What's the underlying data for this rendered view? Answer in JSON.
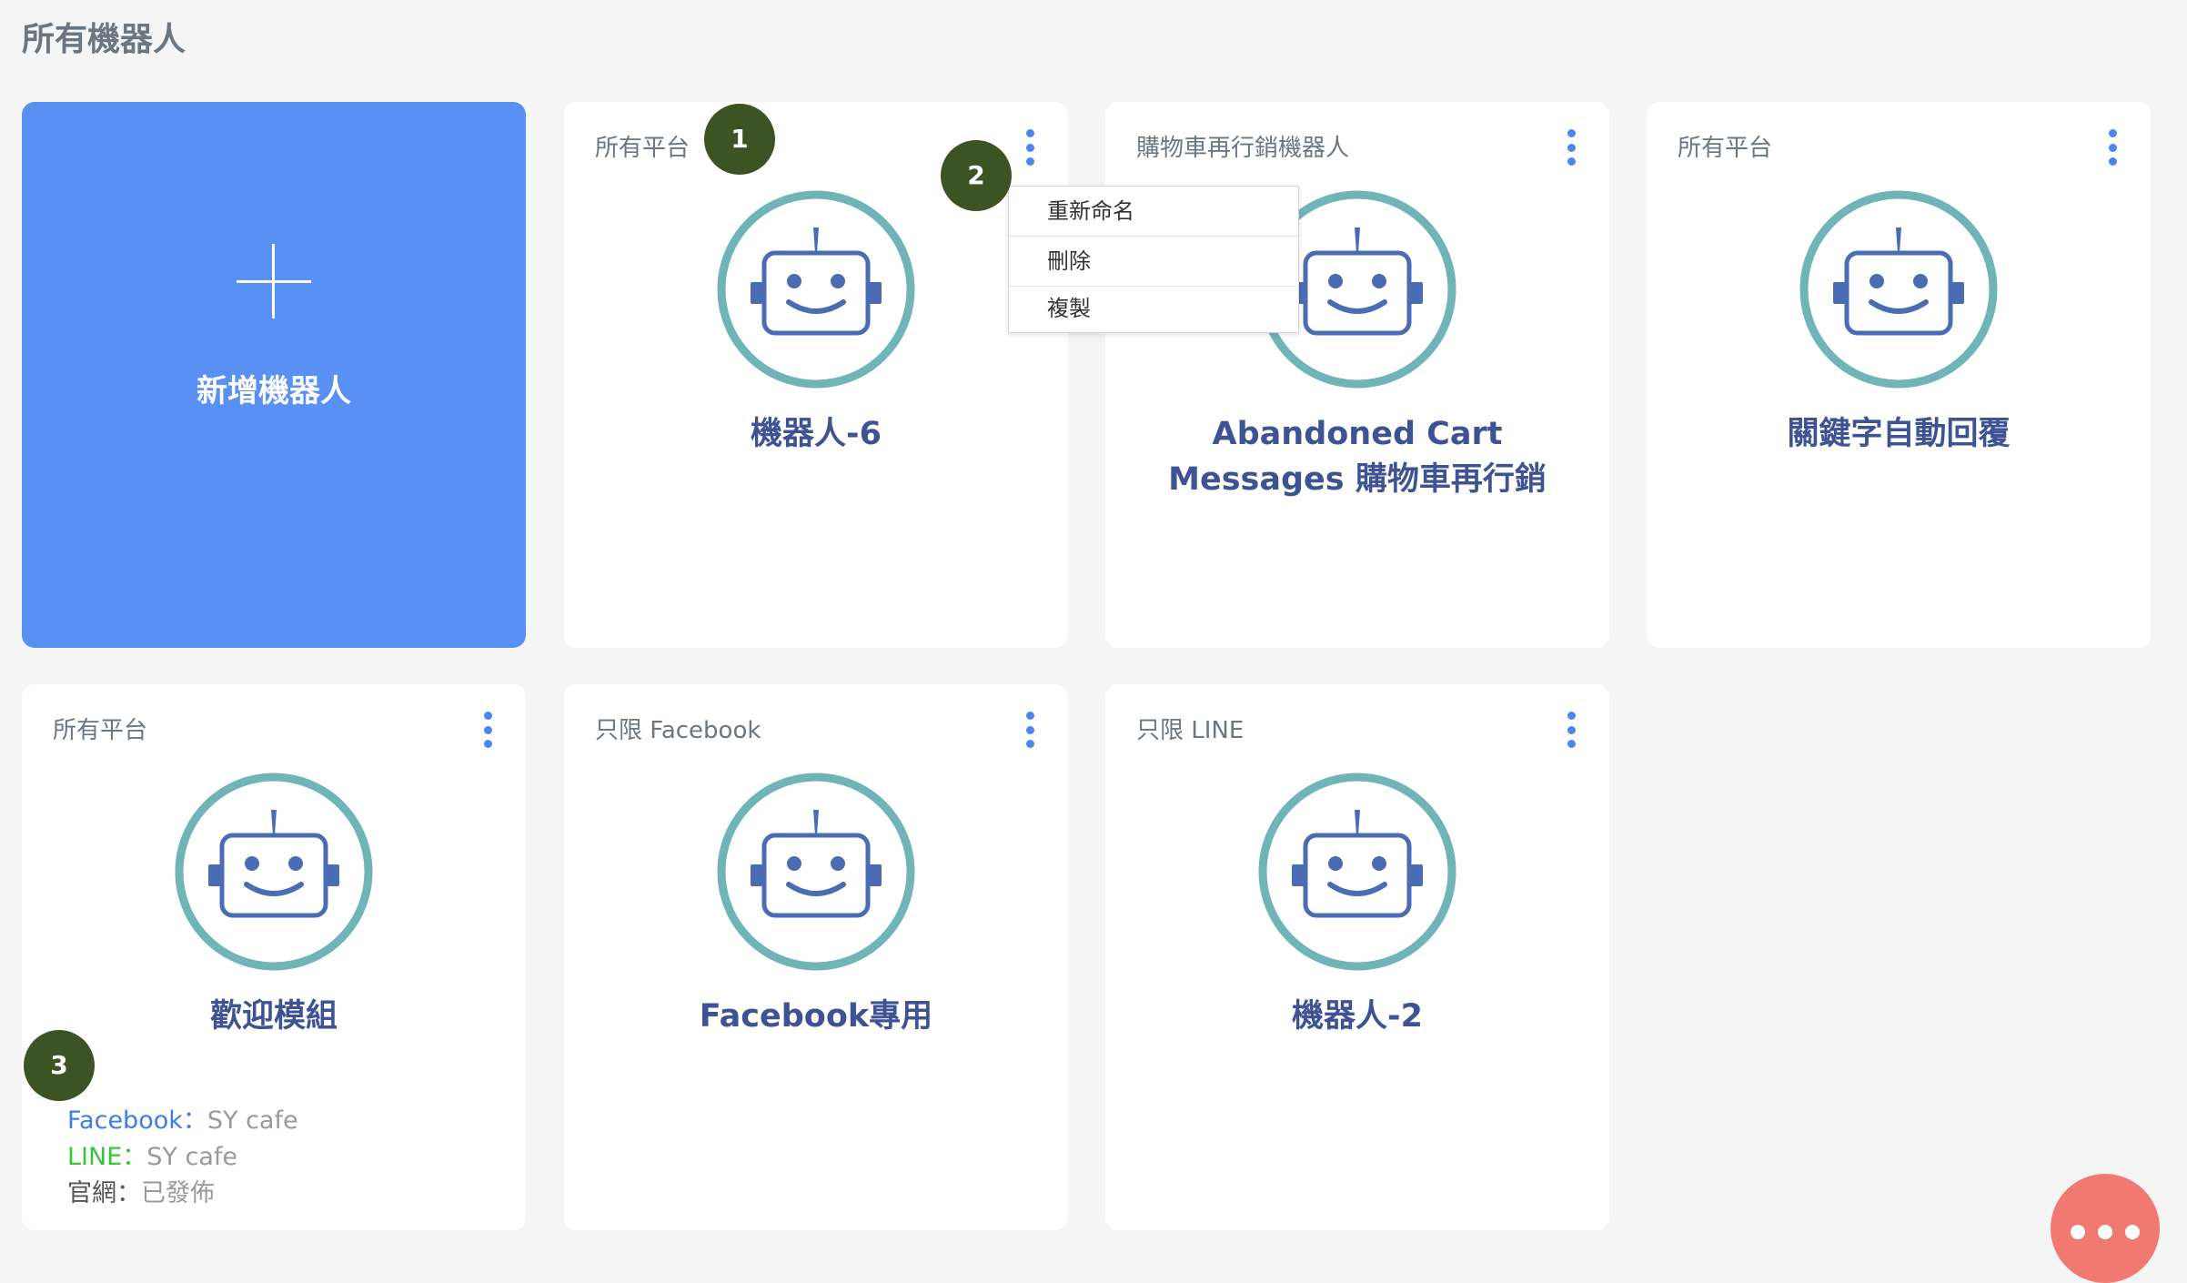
{
  "page_title": "所有機器人",
  "add_card": {
    "label": "新增機器人"
  },
  "bots": [
    {
      "platform": "所有平台",
      "name": "機器人-6"
    },
    {
      "platform": "購物車再行銷機器人",
      "name_line1": "Abandoned Cart",
      "name_line2": "Messages 購物車再行銷"
    },
    {
      "platform": "所有平台",
      "name": "關鍵字自動回覆"
    },
    {
      "platform": "所有平台",
      "name": "歡迎模組",
      "status": {
        "facebook_label": "Facebook：",
        "facebook_value": "SY cafe",
        "line_label": "LINE：",
        "line_value": "SY cafe",
        "web_label": "官網：",
        "web_value": "已發佈"
      }
    },
    {
      "platform": "只限 Facebook",
      "name": "Facebook專用"
    },
    {
      "platform": "只限 LINE",
      "name": "機器人-2"
    }
  ],
  "context_menu": {
    "items": [
      "重新命名",
      "刪除",
      "複製"
    ]
  },
  "markers": [
    "1",
    "2",
    "3"
  ],
  "colors": {
    "add_card": "#5890f3",
    "marker": "#3c5423",
    "robot_ring": "#6fb5b8",
    "robot_face": "#4a6cb5",
    "bot_name": "#3d5394",
    "fab": "#f07a72"
  },
  "icons": {
    "robot": "robot-avatar-icon",
    "menu": "kebab-menu-icon",
    "add": "plus-icon",
    "fab": "more-horizontal-icon"
  }
}
